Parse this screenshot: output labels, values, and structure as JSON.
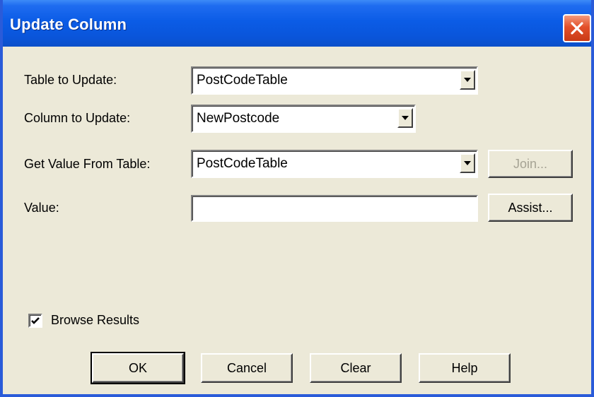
{
  "window": {
    "title": "Update Column"
  },
  "form": {
    "table_to_update": {
      "label": "Table to Update:",
      "value": "PostCodeTable"
    },
    "column_to_update": {
      "label": "Column to Update:",
      "value": "NewPostcode"
    },
    "get_value_from_table": {
      "label": "Get Value From Table:",
      "value": "PostCodeTable"
    },
    "value": {
      "label": "Value:",
      "value": ""
    }
  },
  "side_buttons": {
    "join_label": "Join...",
    "assist_label": "Assist..."
  },
  "browse_results": {
    "label": "Browse Results",
    "checked": true
  },
  "footer": {
    "ok_label": "OK",
    "cancel_label": "Cancel",
    "clear_label": "Clear",
    "help_label": "Help"
  },
  "icons": {
    "close": "close-icon",
    "dropdown": "chevron-down-icon",
    "check": "checkmark-icon"
  },
  "colors": {
    "title_bar": "#0b5ce6",
    "dialog_face": "#ece9d8",
    "close_button": "#e3502a",
    "disabled_text": "#a6a394"
  }
}
